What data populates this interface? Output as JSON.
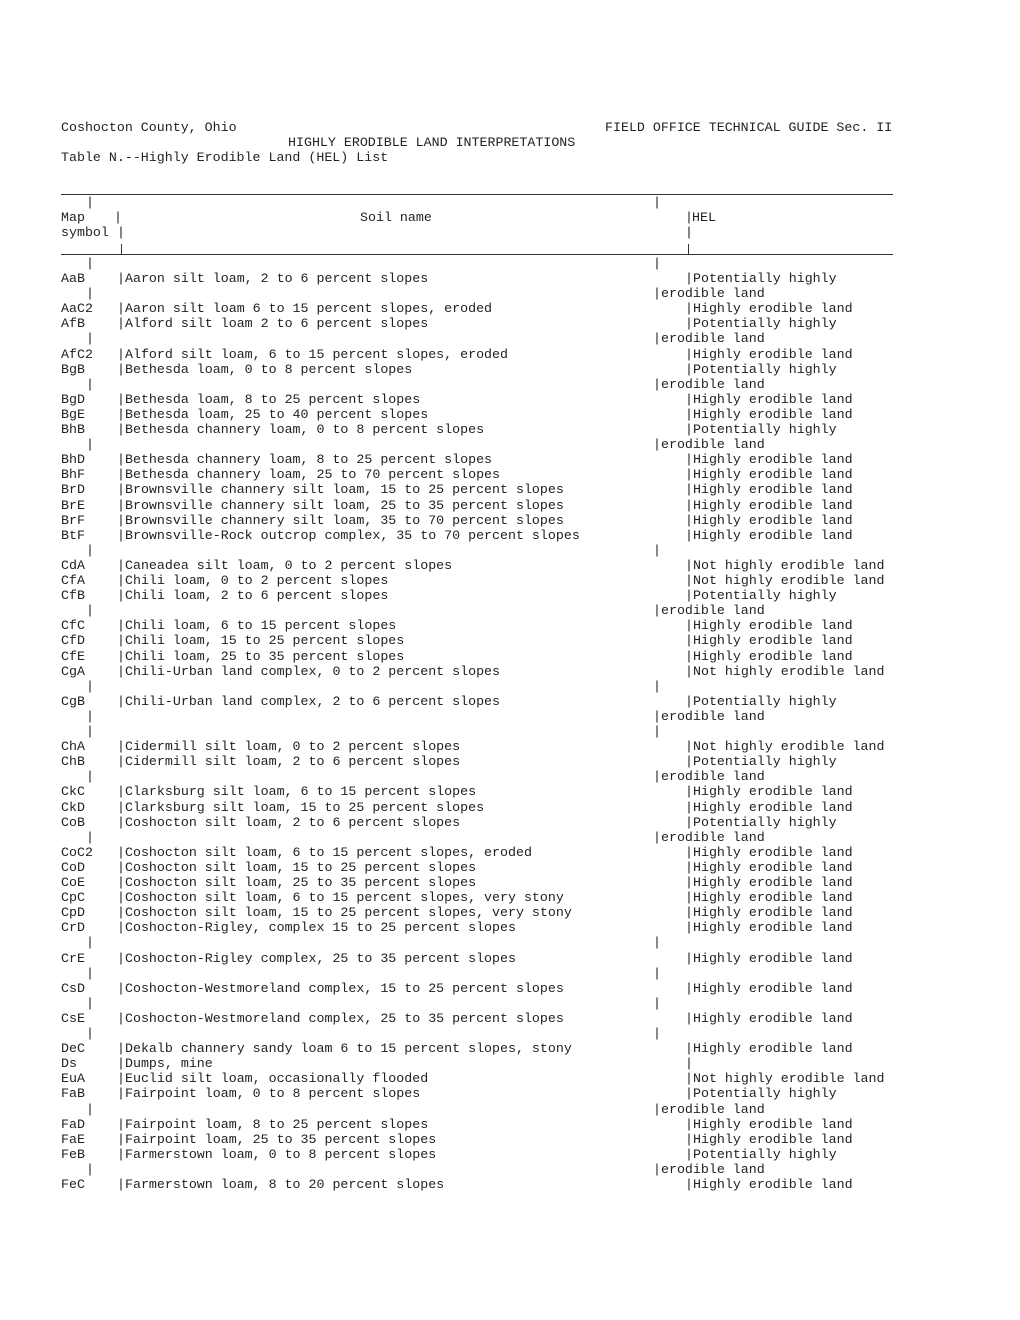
{
  "header": {
    "county": "Coshocton County, Ohio",
    "guide": "FIELD OFFICE TECHNICAL GUIDE Sec. II",
    "subtitle": "HIGHLY ERODIBLE LAND INTERPRETATIONS",
    "table_title": "Table N.--Highly Erodible Land (HEL) List"
  },
  "columns": {
    "symbol_line1": "Map",
    "symbol_line2": "symbol",
    "name": "Soil name",
    "hel": "HEL"
  },
  "rows": [
    {
      "symbol": "AaB",
      "name": "Aaron silt loam, 2 to 6 percent slopes",
      "hel": "Potentially highly",
      "hel2": "erodible land"
    },
    {
      "symbol": "AaC2",
      "name": "Aaron silt loam 6 to 15 percent slopes, eroded",
      "hel": "Highly erodible land"
    },
    {
      "symbol": "AfB",
      "name": "Alford silt loam 2 to 6 percent slopes",
      "hel": "Potentially highly",
      "hel2": "erodible land"
    },
    {
      "symbol": "AfC2",
      "name": "Alford silt loam, 6 to 15 percent slopes, eroded",
      "hel": "Highly erodible land"
    },
    {
      "symbol": "BgB",
      "name": "Bethesda loam, 0 to 8 percent slopes",
      "hel": "Potentially highly",
      "hel2": "erodible land"
    },
    {
      "symbol": "BgD",
      "name": "Bethesda loam, 8 to 25 percent slopes",
      "hel": "Highly erodible land"
    },
    {
      "symbol": "BgE",
      "name": "Bethesda loam, 25 to 40 percent slopes",
      "hel": "Highly erodible land"
    },
    {
      "symbol": "BhB",
      "name": "Bethesda channery loam, 0 to 8 percent slopes",
      "hel": "Potentially highly",
      "hel2": "erodible land"
    },
    {
      "symbol": "BhD",
      "name": "Bethesda channery loam, 8 to 25 percent slopes",
      "hel": "Highly erodible land"
    },
    {
      "symbol": "BhF",
      "name": "Bethesda channery loam, 25 to 70 percent slopes",
      "hel": "Highly erodible land"
    },
    {
      "symbol": "BrD",
      "name": "Brownsville channery silt loam, 15 to 25 percent slopes",
      "hel": "Highly erodible land"
    },
    {
      "symbol": "BrE",
      "name": "Brownsville channery silt loam, 25 to 35 percent slopes",
      "hel": "Highly erodible land"
    },
    {
      "symbol": "BrF",
      "name": "Brownsville channery silt loam, 35 to 70 percent slopes",
      "hel": "Highly erodible land"
    },
    {
      "symbol": "BtF",
      "name": "Brownsville-Rock outcrop complex, 35 to 70 percent slopes",
      "hel": "Highly erodible land",
      "spacer_after": true
    },
    {
      "symbol": "CdA",
      "name": "Caneadea silt loam, 0 to 2 percent slopes",
      "hel": "Not highly erodible land"
    },
    {
      "symbol": "CfA",
      "name": "Chili loam, 0 to 2 percent slopes",
      "hel": "Not highly erodible land"
    },
    {
      "symbol": "CfB",
      "name": "Chili loam, 2 to 6 percent slopes",
      "hel": "Potentially highly",
      "hel2": "erodible land"
    },
    {
      "symbol": "CfC",
      "name": "Chili loam, 6 to 15 percent slopes",
      "hel": "Highly erodible land"
    },
    {
      "symbol": "CfD",
      "name": "Chili loam, 15 to 25 percent slopes",
      "hel": "Highly erodible land"
    },
    {
      "symbol": "CfE",
      "name": "Chili loam, 25 to 35 percent slopes",
      "hel": "Highly erodible land"
    },
    {
      "symbol": "CgA",
      "name": "Chili-Urban land complex, 0 to 2 percent slopes",
      "hel": "Not highly erodible land",
      "spacer_after": true
    },
    {
      "symbol": "CgB",
      "name": "Chili-Urban land complex, 2 to 6 percent slopes",
      "hel": "Potentially highly",
      "hel2": "erodible land",
      "spacer_after": true
    },
    {
      "symbol": "ChA",
      "name": "Cidermill silt loam, 0 to 2 percent slopes",
      "hel": "Not highly erodible land"
    },
    {
      "symbol": "ChB",
      "name": "Cidermill silt loam, 2 to 6 percent slopes",
      "hel": "Potentially highly",
      "hel2": "erodible land"
    },
    {
      "symbol": "CkC",
      "name": "Clarksburg silt loam, 6 to 15 percent slopes",
      "hel": "Highly erodible land"
    },
    {
      "symbol": "CkD",
      "name": "Clarksburg silt loam, 15 to 25 percent slopes",
      "hel": "Highly erodible land"
    },
    {
      "symbol": "CoB",
      "name": "Coshocton silt loam, 2 to 6 percent slopes",
      "hel": "Potentially highly",
      "hel2": "erodible land"
    },
    {
      "symbol": "CoC2",
      "name": "Coshocton silt loam, 6 to 15 percent slopes, eroded",
      "hel": "Highly erodible land"
    },
    {
      "symbol": "CoD",
      "name": "Coshocton silt loam, 15 to 25 percent slopes",
      "hel": "Highly erodible land"
    },
    {
      "symbol": "CoE",
      "name": "Coshocton silt loam, 25 to 35 percent slopes",
      "hel": "Highly erodible land"
    },
    {
      "symbol": "CpC",
      "name": "Coshocton silt loam, 6 to 15 percent slopes, very stony",
      "hel": "Highly erodible land"
    },
    {
      "symbol": "CpD",
      "name": "Coshocton silt loam, 15 to 25 percent slopes, very stony",
      "hel": "Highly erodible land"
    },
    {
      "symbol": "CrD",
      "name": "Coshocton-Rigley, complex 15 to 25 percent slopes",
      "hel": "Highly erodible land",
      "spacer_after": true
    },
    {
      "symbol": "CrE",
      "name": "Coshocton-Rigley complex, 25 to 35 percent slopes",
      "hel": "Highly erodible land",
      "spacer_after": true
    },
    {
      "symbol": "CsD",
      "name": "Coshocton-Westmoreland complex, 15 to 25 percent slopes",
      "hel": "Highly erodible land",
      "spacer_after": true
    },
    {
      "symbol": "CsE",
      "name": "Coshocton-Westmoreland complex, 25 to 35 percent slopes",
      "hel": "Highly erodible land",
      "spacer_after": true
    },
    {
      "symbol": "DeC",
      "name": "Dekalb channery sandy loam 6 to 15 percent slopes, stony",
      "hel": "Highly erodible land"
    },
    {
      "symbol": "Ds",
      "name": "Dumps, mine",
      "hel": ""
    },
    {
      "symbol": "EuA",
      "name": "Euclid silt loam, occasionally flooded",
      "hel": "Not highly erodible land"
    },
    {
      "symbol": "FaB",
      "name": "Fairpoint loam, 0 to 8 percent slopes",
      "hel": "Potentially highly",
      "hel2": "erodible land"
    },
    {
      "symbol": "FaD",
      "name": "Fairpoint loam, 8 to 25 percent slopes",
      "hel": "Highly erodible land"
    },
    {
      "symbol": "FaE",
      "name": "Fairpoint loam, 25 to 35 percent slopes",
      "hel": "Highly erodible land"
    },
    {
      "symbol": "FeB",
      "name": "Farmerstown loam, 0 to 8 percent slopes",
      "hel": "Potentially highly",
      "hel2": "erodible land"
    },
    {
      "symbol": "FeC",
      "name": "Farmerstown loam, 8 to 20 percent slopes",
      "hel": "Highly erodible land"
    }
  ]
}
